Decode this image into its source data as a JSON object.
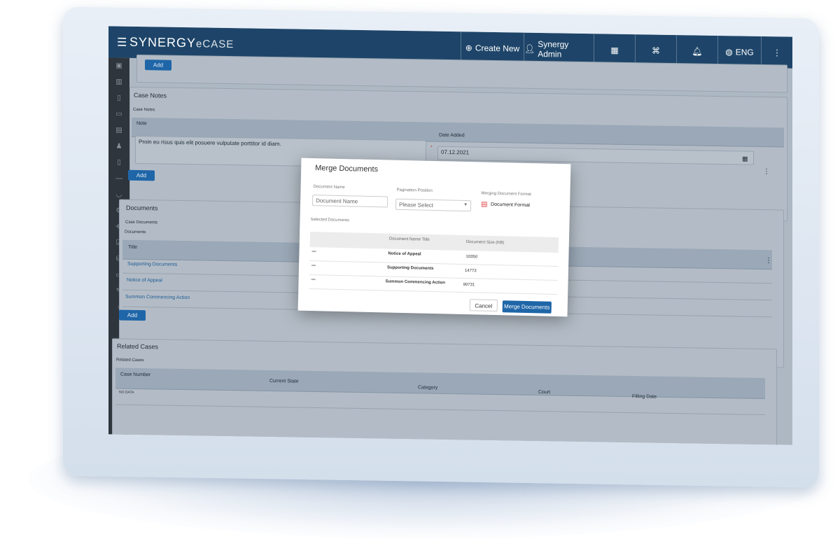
{
  "header": {
    "brand": "SYNERGY",
    "brand_suffix": "eCASE",
    "nav": [
      {
        "icon": "plus-circle-icon",
        "label": "Create New"
      },
      {
        "icon": "user-icon",
        "label": "Synergy Admin"
      },
      {
        "icon": "calendar-icon",
        "label": ""
      },
      {
        "icon": "network-icon",
        "label": ""
      },
      {
        "icon": "bell-icon",
        "label": ""
      },
      {
        "icon": "globe-icon",
        "label": "ENG"
      },
      {
        "icon": "kebab-icon",
        "label": ""
      }
    ]
  },
  "top": {
    "add": "Add"
  },
  "case_notes": {
    "title": "Case Notes",
    "label": "Case Notes",
    "col_note": "Note",
    "col_date": "Date Added",
    "note_value": "Proin eu risus quis elit posuere vulputate porttitor id diam.",
    "date_value": "07.12.2021",
    "add": "Add"
  },
  "documents": {
    "title": "Documents",
    "label1": "Case Documents",
    "label2": "Documents",
    "col_title": "Title",
    "rows": [
      "Supporting Documents",
      "Notice of Appeal",
      "Summon Commencing Action"
    ],
    "add": "Add"
  },
  "related": {
    "title": "Related Cases",
    "label": "Related Cases",
    "cols": [
      "Case Number",
      "Current State",
      "Category",
      "Court",
      "Filling Date"
    ],
    "empty": "NO DATA"
  },
  "modal": {
    "title": "Merge Documents",
    "doc_name_label": "Document Name",
    "doc_name_placeholder": "Document Name",
    "pagination_label": "Pagination Position",
    "pagination_value": "Please Select",
    "format_label": "Merging Document Format",
    "format_value": "Document Format",
    "selected_label": "Selected Documents",
    "col_name": "Document Name Title",
    "col_size": "Document Size (KB)",
    "rows": [
      {
        "name": "Notice of Appeal",
        "size": "10350"
      },
      {
        "name": "Supporting Documents",
        "size": "14773"
      },
      {
        "name": "Summon Commencing Action",
        "size": "90731"
      }
    ],
    "cancel": "Cancel",
    "merge": "Merge Documents"
  },
  "colors": {
    "header": "#1e4569",
    "primary": "#1f66a8",
    "pdf": "#e04a4a"
  }
}
